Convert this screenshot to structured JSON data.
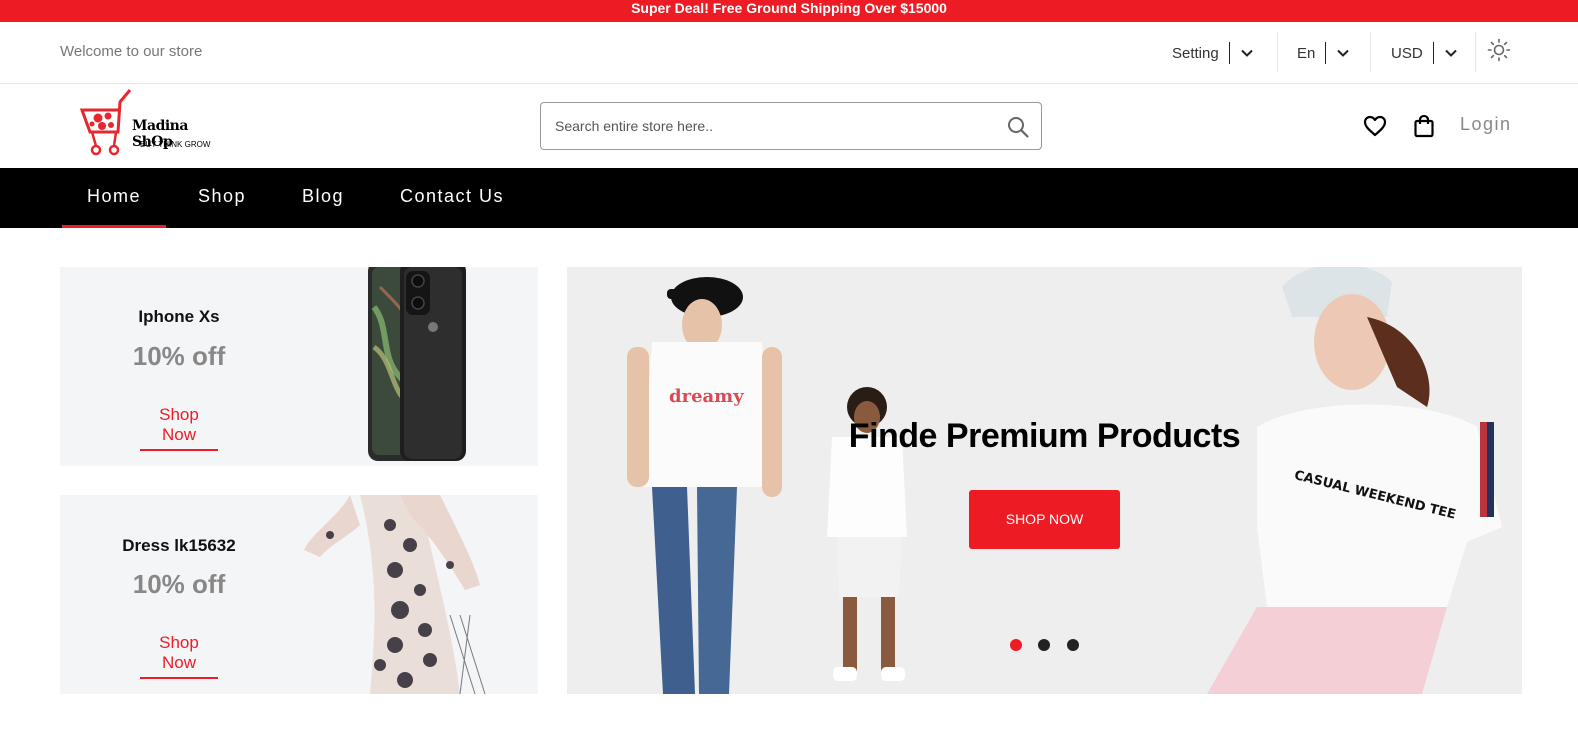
{
  "promo": {
    "text": "Super Deal! Free Ground Shipping Over $15000"
  },
  "topbar": {
    "welcome": "Welcome to our store",
    "setting_label": "Setting",
    "language": "En",
    "currency": "USD"
  },
  "header": {
    "logo_name": "Madina ShOp",
    "logo_tagline": "BUY THINK GROW",
    "search_placeholder": "Search entire store here..",
    "login_label": "Login"
  },
  "nav": {
    "items": [
      {
        "label": "Home",
        "active": true
      },
      {
        "label": "Shop"
      },
      {
        "label": "Blog"
      },
      {
        "label": "Contact Us"
      }
    ]
  },
  "promos": [
    {
      "title": "Iphone Xs",
      "discount": "10% off",
      "link": "Shop Now"
    },
    {
      "title": "Dress lk15632",
      "discount": "10% off",
      "link": "Shop Now"
    }
  ],
  "hero": {
    "title": "Finde Premium Products",
    "button": "SHOP NOW",
    "slide_count": 3,
    "active_slide": 1
  },
  "colors": {
    "accent": "#ed1c24",
    "nav_bg": "#000000",
    "card_bg": "#f4f5f7"
  }
}
